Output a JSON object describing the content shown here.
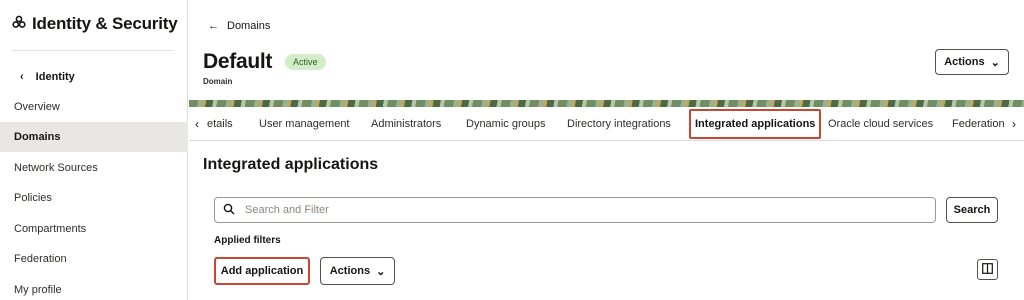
{
  "sidebar": {
    "app_title": "Identity & Security",
    "back_label": "Identity",
    "items": [
      {
        "label": "Overview"
      },
      {
        "label": "Domains"
      },
      {
        "label": "Network Sources"
      },
      {
        "label": "Policies"
      },
      {
        "label": "Compartments"
      },
      {
        "label": "Federation"
      },
      {
        "label": "My profile"
      }
    ],
    "active_item": "Domains"
  },
  "header": {
    "breadcrumb": "Domains",
    "title": "Default",
    "status_badge": "Active",
    "subtitle": "Domain",
    "actions_label": "Actions"
  },
  "tabs": [
    {
      "label": "etails"
    },
    {
      "label": "User management"
    },
    {
      "label": "Administrators"
    },
    {
      "label": "Dynamic groups"
    },
    {
      "label": "Directory integrations"
    },
    {
      "label": "Integrated applications"
    },
    {
      "label": "Oracle cloud services"
    },
    {
      "label": "Federation"
    }
  ],
  "active_tab": "Integrated applications",
  "content": {
    "section_title": "Integrated applications",
    "search_placeholder": "Search and Filter",
    "search_button": "Search",
    "applied_filters_label": "Applied filters",
    "add_button": "Add application",
    "actions_label": "Actions"
  },
  "colors": {
    "highlight": "#c74634",
    "badge_bg": "#d4edc9",
    "active_item_bg": "#e9e7e4"
  }
}
